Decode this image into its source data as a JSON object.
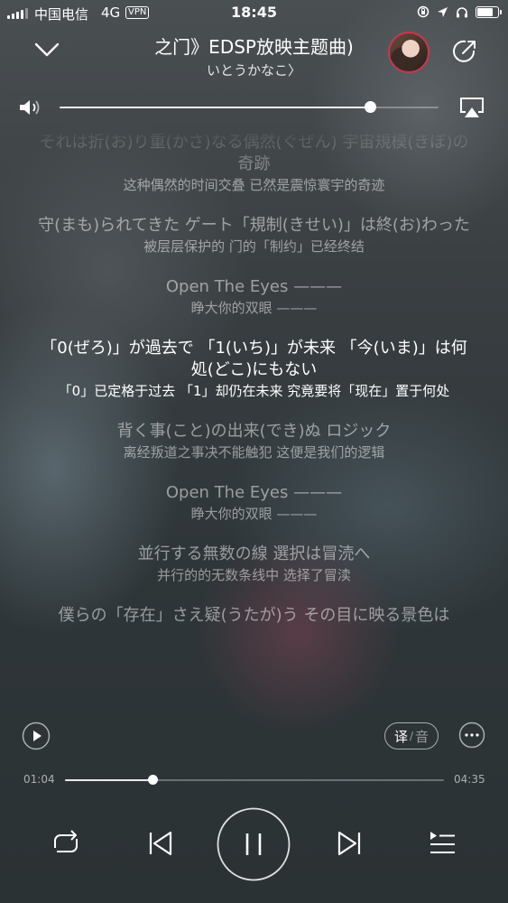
{
  "status_bar": {
    "carrier": "中国电信",
    "network": "4G",
    "vpn": "VPN",
    "time": "18:45",
    "battery_level": 0.85
  },
  "header": {
    "song_title": "之门》EDSP放映主题曲)",
    "artist": "いとうかなこ〉"
  },
  "volume": {
    "level": 0.82
  },
  "lyrics": [
    {
      "orig": "それは折(お)り重(かさ)なる偶然(ぐぜん) 宇宙規模(きぼ)の奇跡",
      "trans": "这种偶然的时间交叠 已然是震惊寰宇的奇迹",
      "active": false
    },
    {
      "orig": "守(まも)られてきた ゲート「規制(きせい)」は終(お)わった",
      "trans": "被层层保护的 门的「制约」已经终结",
      "active": false
    },
    {
      "orig": "Open The Eyes ———",
      "trans": "睁大你的双眼 ———",
      "active": false
    },
    {
      "orig": "「0(ぜろ)」が過去で 「1(いち)」が未来 「今(いま)」は何処(どこ)にもない",
      "trans": "「0」已定格于过去 「1」却仍在未来 究竟要将「现在」置于何处",
      "active": true
    },
    {
      "orig": "背く事(こと)の出来(でき)ぬ ロジック",
      "trans": "离经叛道之事决不能触犯 这便是我们的逻辑",
      "active": false
    },
    {
      "orig": "Open The Eyes ———",
      "trans": "睁大你的双眼 ———",
      "active": false
    },
    {
      "orig": "並行する無数の線 選択は冒涜へ",
      "trans": "并行的的无数条线中 选择了冒渎",
      "active": false
    },
    {
      "orig": "僕らの「存在」さえ疑(うたが)う その目に映る景色は",
      "trans": "",
      "active": false
    }
  ],
  "controls": {
    "translate_label": "译",
    "phonetic_label": "音",
    "elapsed": "01:04",
    "duration": "04:35",
    "progress": 0.23
  },
  "icons": {
    "collapse": "chevron-down-icon",
    "share": "share-icon",
    "volume": "speaker-icon",
    "airplay": "airplay-icon",
    "mini_play": "play-icon",
    "more": "more-icon",
    "repeat": "repeat-icon",
    "previous": "previous-icon",
    "pause": "pause-icon",
    "next": "next-icon",
    "playlist": "playlist-icon"
  }
}
